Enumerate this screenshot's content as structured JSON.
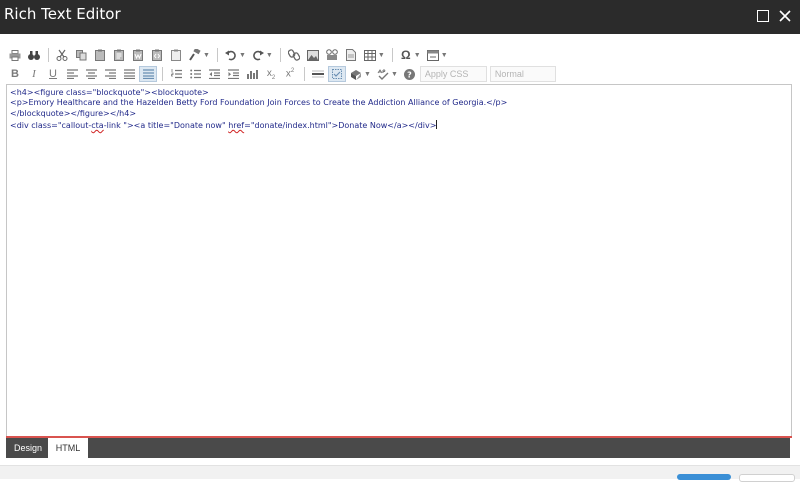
{
  "window": {
    "title": "Rich Text Editor"
  },
  "toolbar": {
    "style_placeholder": "Apply CSS C...",
    "format_value": "Normal"
  },
  "editor": {
    "lines": [
      "<h4><figure class=\"blockquote\"><blockquote>",
      "<p>Emory Healthcare and the Hazelden Betty Ford Foundation Join Forces to Create the Addiction Alliance of Georgia.</p>",
      "</blockquote></figure></h4>"
    ],
    "line4": {
      "part1": "<div class=\"callout-",
      "part2": "cta",
      "part3": "-link \"><a title=\"Donate now\" ",
      "part4": "href",
      "part5": "=\"donate/index.html\">Donate Now</a></div>"
    }
  },
  "tabs": {
    "design": "Design",
    "html": "HTML"
  },
  "colors": {
    "titlebar": "#2b2b2b",
    "accent_line": "#d9534f",
    "tabbar": "#4a4a4a",
    "code_text": "#222a8a",
    "primary_button": "#3a8fd6"
  }
}
